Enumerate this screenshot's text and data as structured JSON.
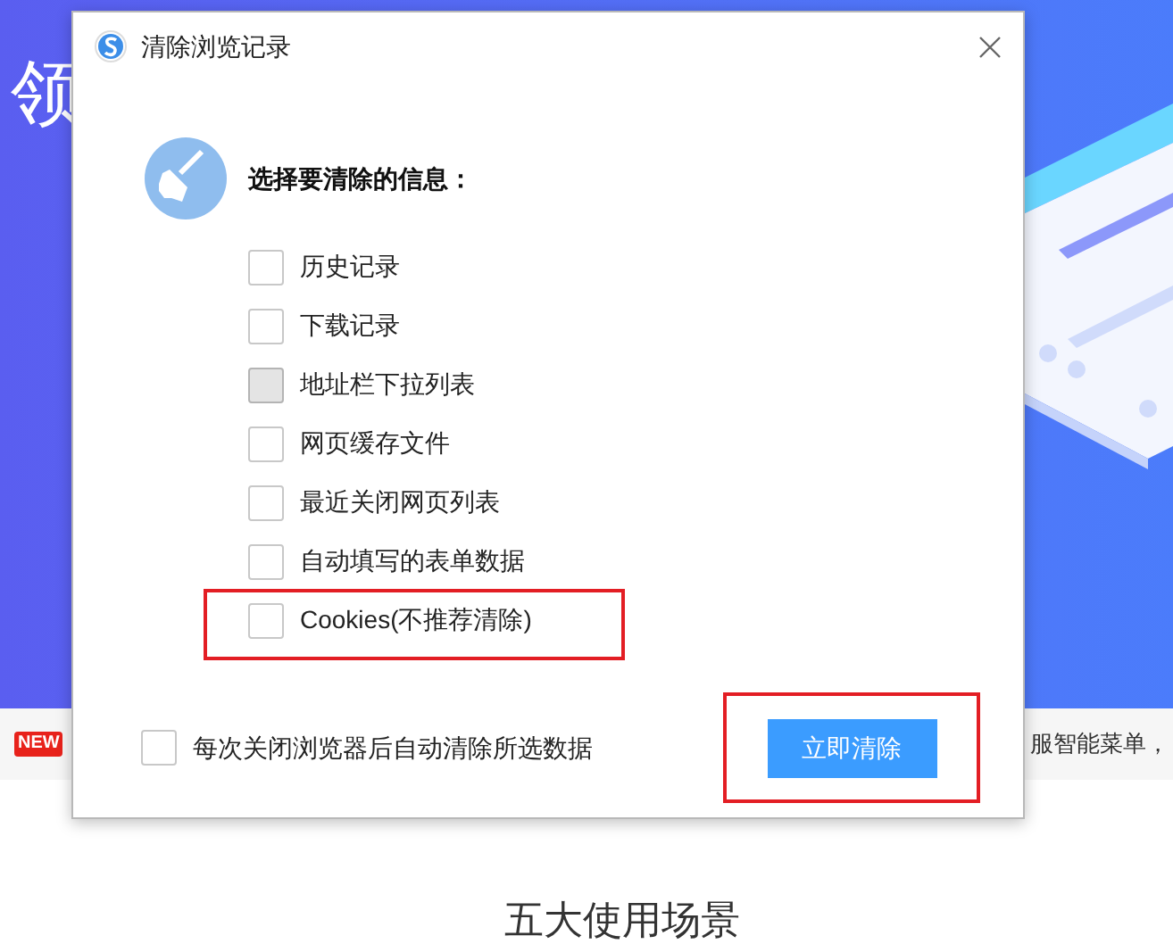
{
  "page": {
    "hero_text": "领",
    "strip_left_badge": "NEW",
    "strip_right_text": "服智能菜单，",
    "section_title": "五大使用场景"
  },
  "dialog": {
    "title": "清除浏览记录",
    "heading": "选择要清除的信息：",
    "options": [
      {
        "label": "历史记录",
        "checked": false,
        "disabled": false,
        "highlighted": false
      },
      {
        "label": "下载记录",
        "checked": false,
        "disabled": false,
        "highlighted": false
      },
      {
        "label": "地址栏下拉列表",
        "checked": false,
        "disabled": true,
        "highlighted": false
      },
      {
        "label": "网页缓存文件",
        "checked": false,
        "disabled": false,
        "highlighted": false
      },
      {
        "label": "最近关闭网页列表",
        "checked": false,
        "disabled": false,
        "highlighted": false
      },
      {
        "label": "自动填写的表单数据",
        "checked": false,
        "disabled": false,
        "highlighted": false
      },
      {
        "label": "Cookies(不推荐清除)",
        "checked": false,
        "disabled": false,
        "highlighted": true
      }
    ],
    "auto_clear": {
      "label": "每次关闭浏览器后自动清除所选数据",
      "checked": false
    },
    "button": {
      "label": "立即清除",
      "highlighted": true
    }
  }
}
